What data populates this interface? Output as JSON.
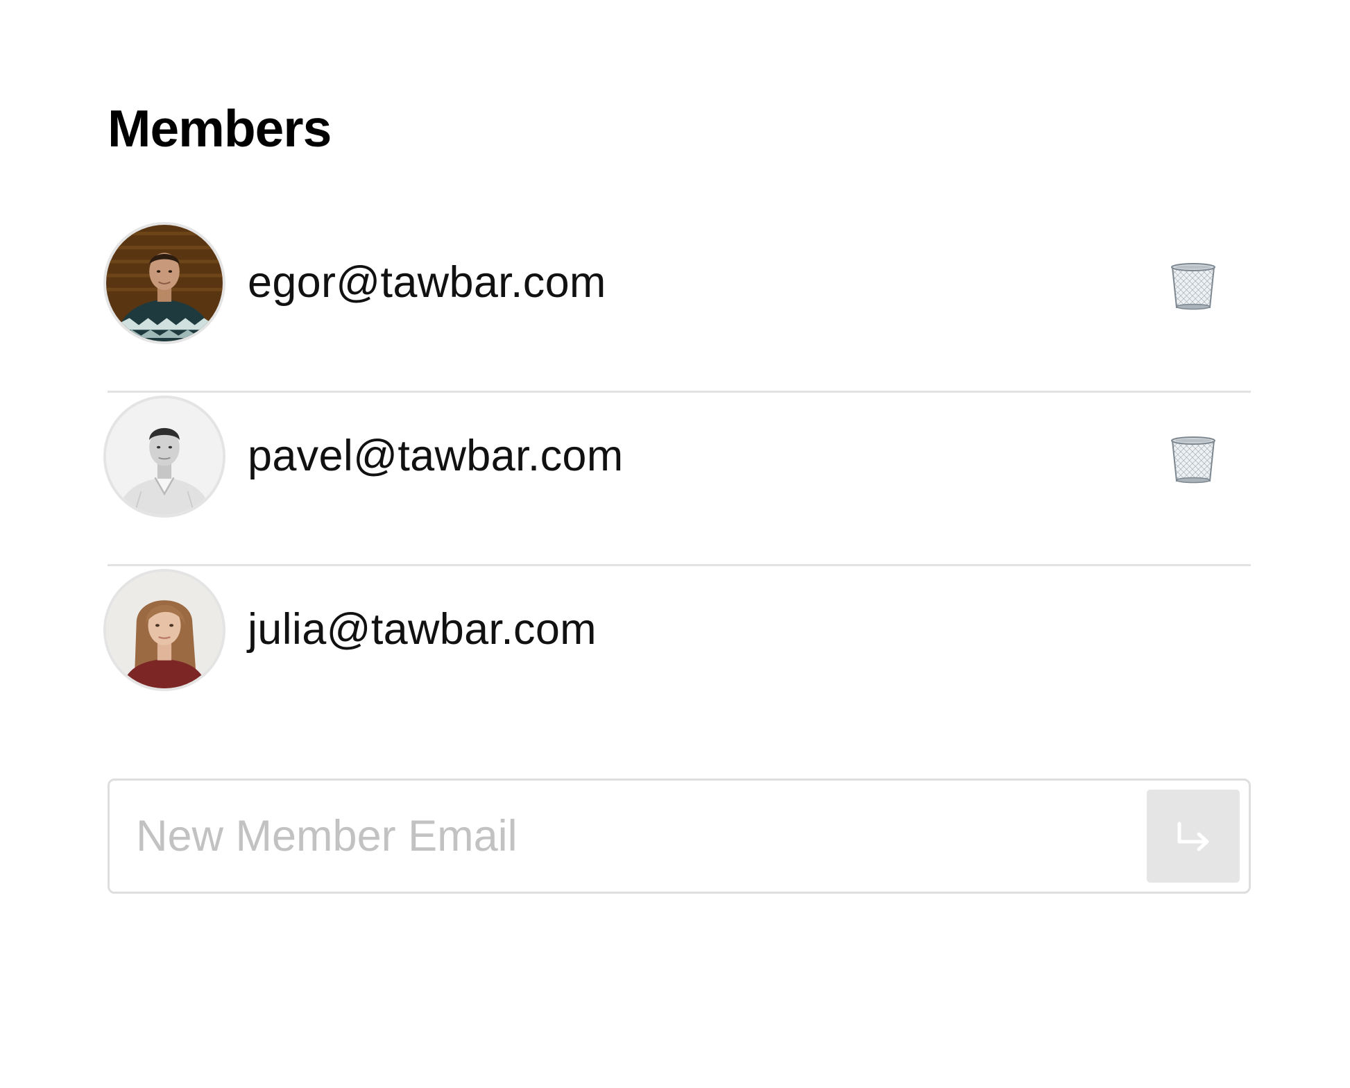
{
  "header": {
    "title": "Members"
  },
  "members": [
    {
      "email": "egor@tawbar.com",
      "avatar": "egor-avatar-photo",
      "can_remove": true,
      "remove_icon": "trash-can-icon"
    },
    {
      "email": "pavel@tawbar.com",
      "avatar": "pavel-avatar-photo",
      "can_remove": true,
      "remove_icon": "trash-can-icon"
    },
    {
      "email": "julia@tawbar.com",
      "avatar": "julia-avatar-photo",
      "can_remove": false
    }
  ],
  "new_member": {
    "value": "",
    "placeholder": "New Member Email",
    "submit_icon": "enter-return-icon"
  },
  "colors": {
    "text": "#111111",
    "divider": "#e2e2e2",
    "placeholder": "#c2c2c2",
    "submit_bg": "#e5e5e5",
    "submit_icon": "#ffffff"
  }
}
